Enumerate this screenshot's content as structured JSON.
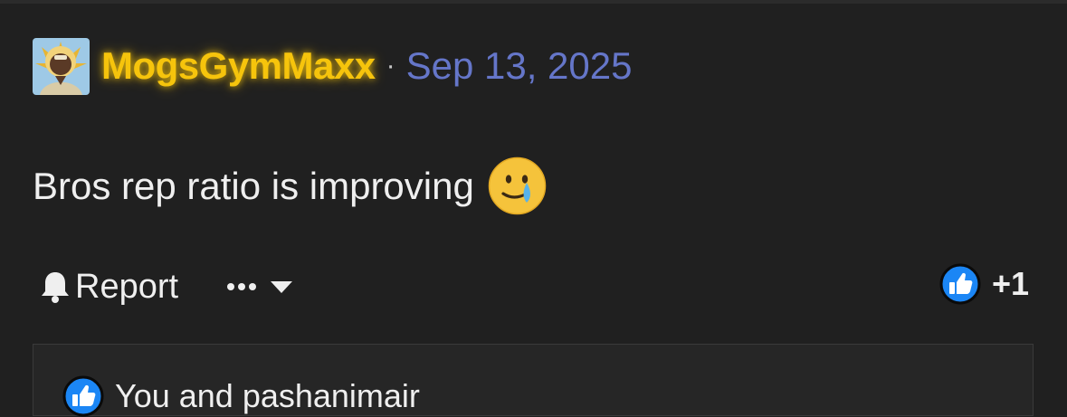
{
  "post": {
    "author": "MogsGymMaxx",
    "separator": "·",
    "date": "Sep 13, 2025",
    "message": "Bros rep ratio is improving",
    "emoji_icon": "face-holding-back-tears-icon"
  },
  "actions": {
    "report_label": "Report",
    "report_icon": "bell-icon",
    "more_icon": "ellipsis-icon",
    "dropdown_icon": "caret-down-icon"
  },
  "reactions": {
    "icon": "thumbs-up-icon",
    "count": "+1",
    "summary": "You and pashanimair"
  },
  "colors": {
    "background": "#202020",
    "username": "#f6c40c",
    "date": "#6576c9",
    "like_blue": "#1b86f5",
    "text": "#efefef"
  }
}
